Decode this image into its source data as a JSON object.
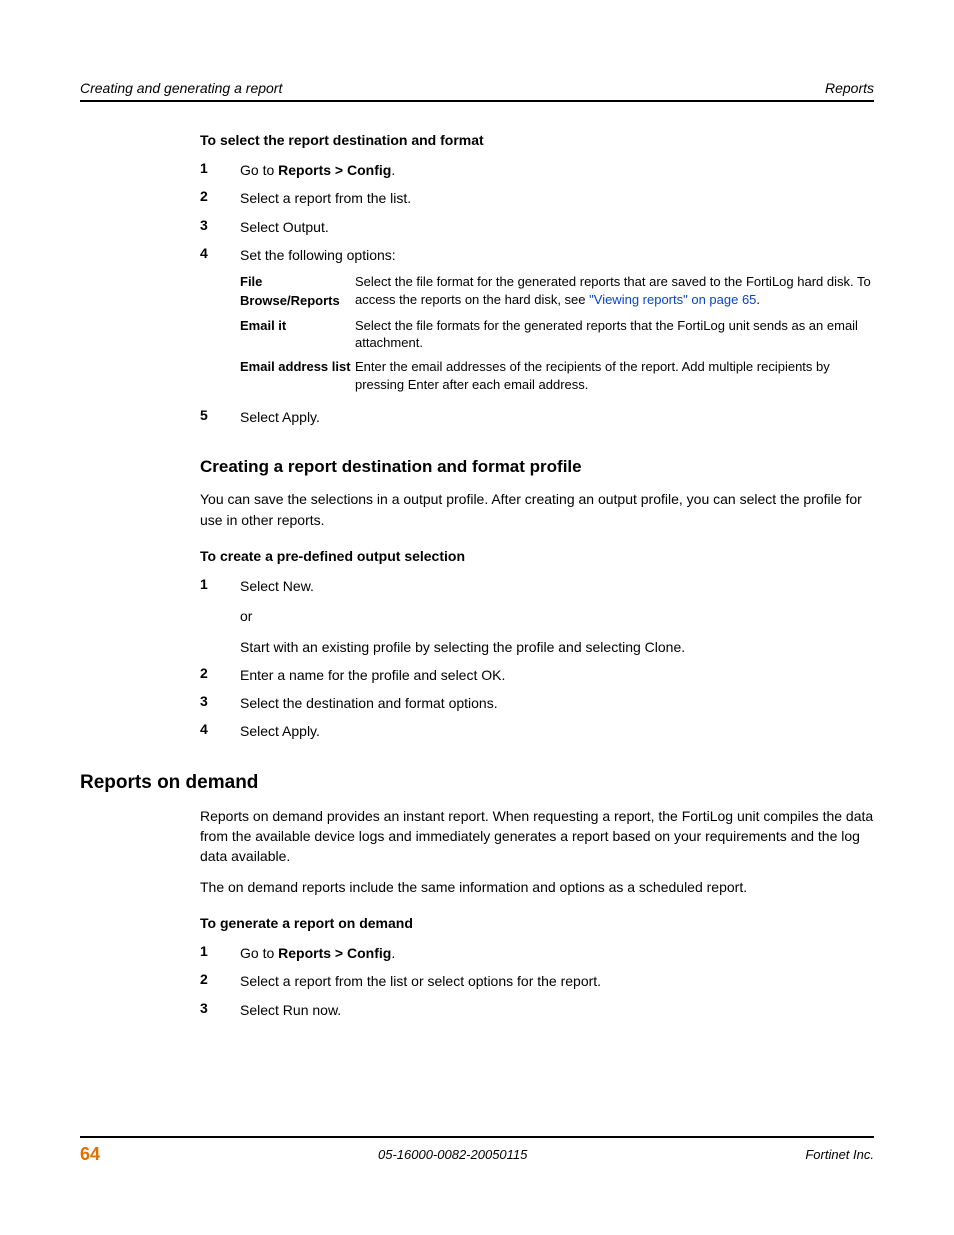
{
  "header": {
    "left": "Creating and generating a report",
    "right": "Reports"
  },
  "s1": {
    "heading": "To select the report destination and format",
    "steps": {
      "n1": "1",
      "t1a": "Go to ",
      "t1b": "Reports > Config",
      "t1c": ".",
      "n2": "2",
      "t2": "Select a report from the list.",
      "n3": "3",
      "t3": "Select Output.",
      "n4": "4",
      "t4": "Set the following options:",
      "n5": "5",
      "t5": "Select Apply."
    },
    "opts": {
      "l1": "File Browse/Reports",
      "d1a": "Select the file format for the generated reports that are saved to the FortiLog hard disk. To access the reports on the hard disk, see ",
      "d1b": "\"Viewing reports\" on page 65",
      "d1c": ".",
      "l2": "Email it",
      "d2": "Select the file formats for the generated reports that the FortiLog unit sends as an email attachment.",
      "l3": "Email address list",
      "d3": "Enter the email addresses of the recipients of the report. Add multiple recipients by pressing Enter after each email address."
    }
  },
  "s2": {
    "h3": "Creating a report destination and format profile",
    "p1": "You can save the selections in a output profile. After creating an output profile, you can select the profile for use in other reports.",
    "heading": "To create a pre-defined output selection",
    "steps": {
      "n1": "1",
      "t1a": "Select New.",
      "t1b": "or",
      "t1c": "Start with an existing profile by selecting the profile and selecting Clone.",
      "n2": "2",
      "t2": "Enter a name for the profile and select OK.",
      "n3": "3",
      "t3": "Select the destination and format options.",
      "n4": "4",
      "t4": "Select Apply."
    }
  },
  "s3": {
    "h2": "Reports on demand",
    "p1": "Reports on demand provides an instant report. When requesting a report, the FortiLog unit compiles the data from the available device logs and immediately generates a report based on your requirements and the log data available.",
    "p2": "The on demand reports include the same information and options as a scheduled report.",
    "heading": "To generate a report on demand",
    "steps": {
      "n1": "1",
      "t1a": "Go to ",
      "t1b": "Reports > Config",
      "t1c": ".",
      "n2": "2",
      "t2": "Select a report from the list or select options for the report.",
      "n3": "3",
      "t3": "Select Run now."
    }
  },
  "footer": {
    "page": "64",
    "docid": "05-16000-0082-20050115",
    "company": "Fortinet Inc."
  }
}
